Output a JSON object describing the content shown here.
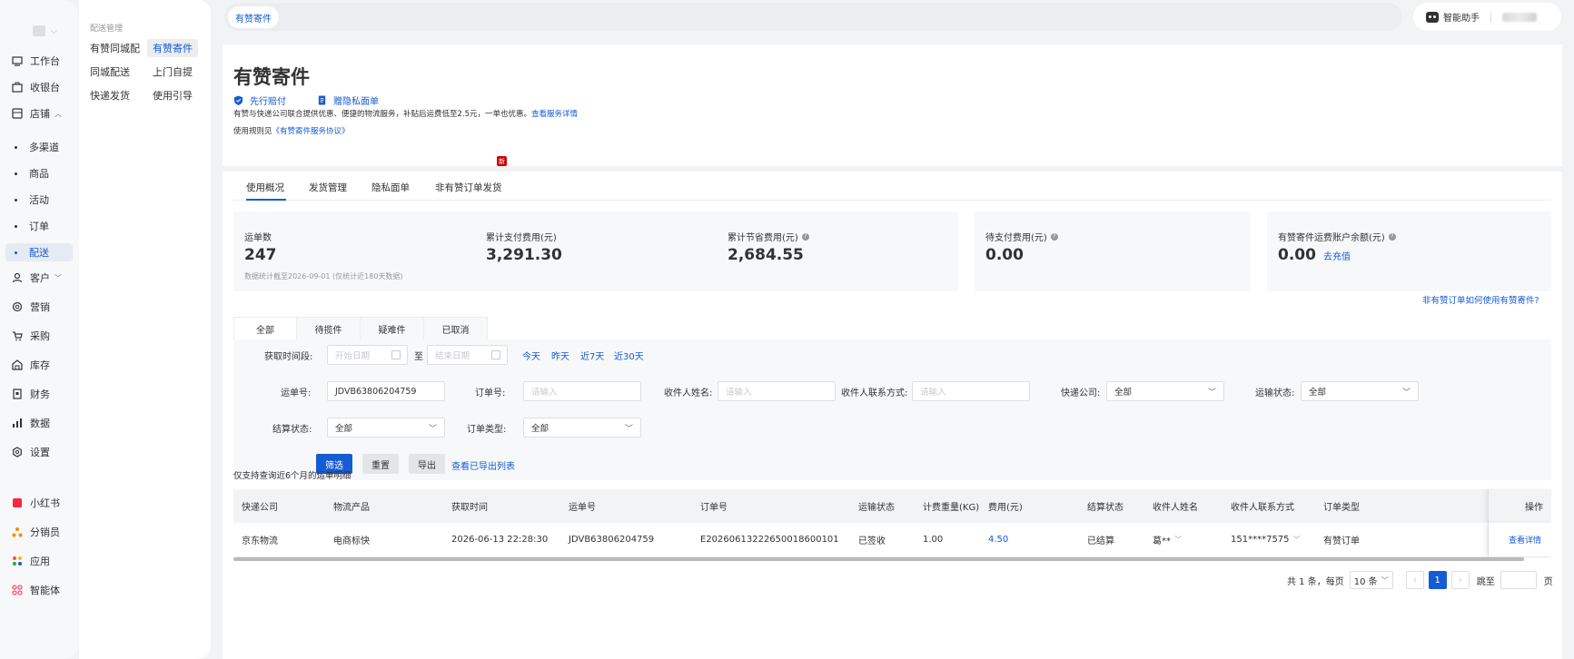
{
  "rail": {
    "items": [
      {
        "label": "工作台",
        "icon": "workbench-icon"
      },
      {
        "label": "收银台",
        "icon": "cashier-icon"
      },
      {
        "label": "店铺",
        "icon": "store-icon"
      },
      {
        "label": "客户",
        "icon": "customer-icon"
      },
      {
        "label": "营销",
        "icon": "marketing-icon"
      },
      {
        "label": "采购",
        "icon": "cart-icon"
      },
      {
        "label": "库存",
        "icon": "warehouse-icon"
      },
      {
        "label": "财务",
        "icon": "finance-icon"
      },
      {
        "label": "数据",
        "icon": "chart-icon"
      },
      {
        "label": "设置",
        "icon": "settings-icon"
      }
    ],
    "store_subitems": [
      "多渠道",
      "商品",
      "活动",
      "订单",
      "配送"
    ],
    "apps": [
      {
        "label": "小红书",
        "icon": "xiaohongshu-icon",
        "color": "#ff2442"
      },
      {
        "label": "分销员",
        "icon": "distributor-icon",
        "color": "#ff8a00"
      },
      {
        "label": "应用",
        "icon": "apps-icon"
      },
      {
        "label": "智能体",
        "icon": "agent-icon",
        "color": "#ff4d6d"
      }
    ]
  },
  "panel2": {
    "title": "配送管理",
    "items": [
      "有赞同城配",
      "有赞寄件",
      "同城配送",
      "上门自提",
      "快递发货",
      "使用引导"
    ]
  },
  "topbar": {
    "tab": "有赞寄件",
    "assistant": "智能助手"
  },
  "header": {
    "title": "有赞寄件",
    "badges": [
      "先行赔付",
      "赠隐私面单"
    ],
    "desc": "有赞与快递公司联合提供优惠、便捷的物流服务，补贴后运费低至2.5元，一单也优惠。",
    "desc_link": "查看服务详情",
    "rule_prefix": "使用规则见",
    "rule_link": "《有赞寄件服务协议》"
  },
  "tabs": {
    "items": [
      "使用概况",
      "发货管理",
      "隐私面单",
      "非有赞订单发货"
    ],
    "new_tag": "新"
  },
  "stats": {
    "waybill_label": "运单数",
    "waybill_value": "247",
    "paid_label": "累计支付费用(元)",
    "paid_value": "3,291.30",
    "saved_label": "累计节省费用(元)",
    "saved_value": "2,684.55",
    "note": "数据统计截至2026-09-01 (仅统计近180天数据)",
    "pending_label": "待支付费用(元)",
    "pending_value": "0.00",
    "balance_label": "有赞寄件运费账户余额(元)",
    "balance_value": "0.00",
    "recharge": "去充值"
  },
  "status_tabs": [
    "全部",
    "待揽件",
    "疑难件",
    "已取消"
  ],
  "help_link": "非有赞订单如何使用有赞寄件?",
  "filter": {
    "time_label": "获取时间段:",
    "start_ph": "开始日期",
    "to": "至",
    "end_ph": "结束日期",
    "quick": [
      "今天",
      "昨天",
      "近7天",
      "近30天"
    ],
    "waybill_label": "运单号:",
    "waybill_value": "JDVB63806204759",
    "order_label": "订单号:",
    "order_ph": "请输入",
    "name_label": "收件人姓名:",
    "name_ph": "请输入",
    "contact_label": "收件人联系方式:",
    "contact_ph": "请输入",
    "courier_label": "快递公司:",
    "courier_value": "全部",
    "transport_label": "运输状态:",
    "transport_value": "全部",
    "settle_label": "结算状态:",
    "settle_value": "全部",
    "otype_label": "订单类型:",
    "otype_value": "全部",
    "btn_filter": "筛选",
    "btn_reset": "重置",
    "btn_export": "导出",
    "export_list": "查看已导出列表"
  },
  "table": {
    "note": "仅支持查询近6个月的运单明细",
    "headers": [
      "快递公司",
      "物流产品",
      "获取时间",
      "运单号",
      "订单号",
      "运输状态",
      "计费重量(KG)",
      "费用(元)",
      "结算状态",
      "收件人姓名",
      "收件人联系方式",
      "订单类型",
      "操作"
    ],
    "rows": [
      [
        "京东物流",
        "电商标快",
        "2026-06-13 22:28:30",
        "JDVB63806204759",
        "E20260613222650018600101",
        "已签收",
        "1.00",
        "4.50",
        "已结算",
        "葛**",
        "151****7575",
        "有赞订单",
        "查看详情"
      ]
    ]
  },
  "pager": {
    "total": "共 1 条，每页",
    "size": "10 条",
    "page": "1",
    "jump": "跳至",
    "unit": "页"
  }
}
